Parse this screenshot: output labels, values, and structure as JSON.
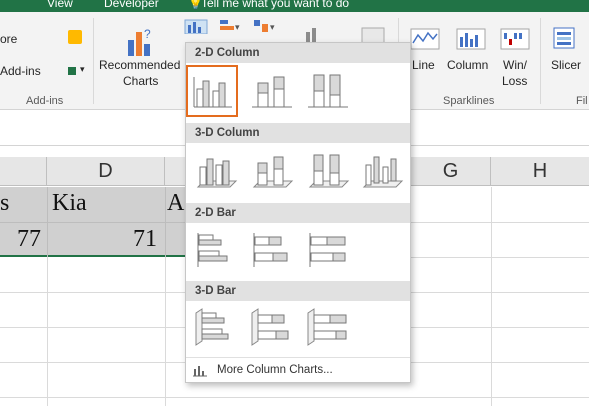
{
  "tabs": {
    "view": "View",
    "developer": "Developer",
    "tell_me": "Tell me what you want to do"
  },
  "ribbon": {
    "store_partial": "ore",
    "addins_item": "Add-ins",
    "addins_group": "Add-ins",
    "recommended_charts": [
      "Recommended",
      "Charts"
    ],
    "sparklines": {
      "line": "Line",
      "column": "Column",
      "winloss": [
        "Win/",
        "Loss"
      ],
      "group": "Sparklines"
    },
    "slicer": "Slicer",
    "filters_partial": "Fil"
  },
  "grid": {
    "columns": [
      "D",
      "G",
      "H"
    ],
    "row1": {
      "c_partial": "s",
      "d": "Kia",
      "e_partial": "A"
    },
    "row2": {
      "c_value": "77",
      "d_value": "71"
    }
  },
  "menu": {
    "sections": [
      "2-D Column",
      "3-D Column",
      "2-D Bar",
      "3-D Bar"
    ],
    "more": "More Column Charts...",
    "selected_option": "Clustered Column",
    "accent_color": "#e46c1e"
  }
}
